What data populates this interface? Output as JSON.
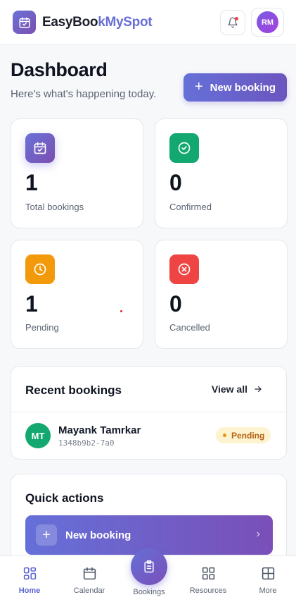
{
  "header": {
    "brand_part1": "EasyBoo",
    "brand_part2": "kMySpot",
    "avatar_initials": "RM"
  },
  "page": {
    "title": "Dashboard",
    "subtitle": "Here's what's happening today.",
    "new_booking_label": "New booking"
  },
  "stats": [
    {
      "value": "1",
      "label": "Total bookings",
      "icon": "calendar-check-icon",
      "color": "#6b5fd0"
    },
    {
      "value": "0",
      "label": "Confirmed",
      "icon": "check-circle-icon",
      "color": "#12a870"
    },
    {
      "value": "1",
      "label": "Pending",
      "icon": "clock-icon",
      "color": "#f29a0b"
    },
    {
      "value": "0",
      "label": "Cancelled",
      "icon": "x-circle-icon",
      "color": "#ef4444"
    }
  ],
  "recent": {
    "title": "Recent bookings",
    "view_all": "View all",
    "items": [
      {
        "initials": "MT",
        "name": "Mayank Tamrkar",
        "id": "1348b9b2-7a0",
        "status": "Pending"
      }
    ]
  },
  "quick_actions": {
    "title": "Quick actions",
    "items": [
      {
        "label": "New booking"
      }
    ]
  },
  "nav": {
    "items": [
      {
        "label": "Home",
        "icon": "home-grid-icon",
        "active": true
      },
      {
        "label": "Calendar",
        "icon": "calendar-icon"
      },
      {
        "label": "Bookings",
        "icon": "clipboard-icon"
      },
      {
        "label": "Resources",
        "icon": "grid-icon"
      },
      {
        "label": "More",
        "icon": "more-grid-icon"
      }
    ]
  },
  "colors": {
    "accent": "#6570d8",
    "accent_end": "#7a4fb8",
    "pending_bg": "#fdf3cf",
    "pending_text": "#b36212"
  }
}
